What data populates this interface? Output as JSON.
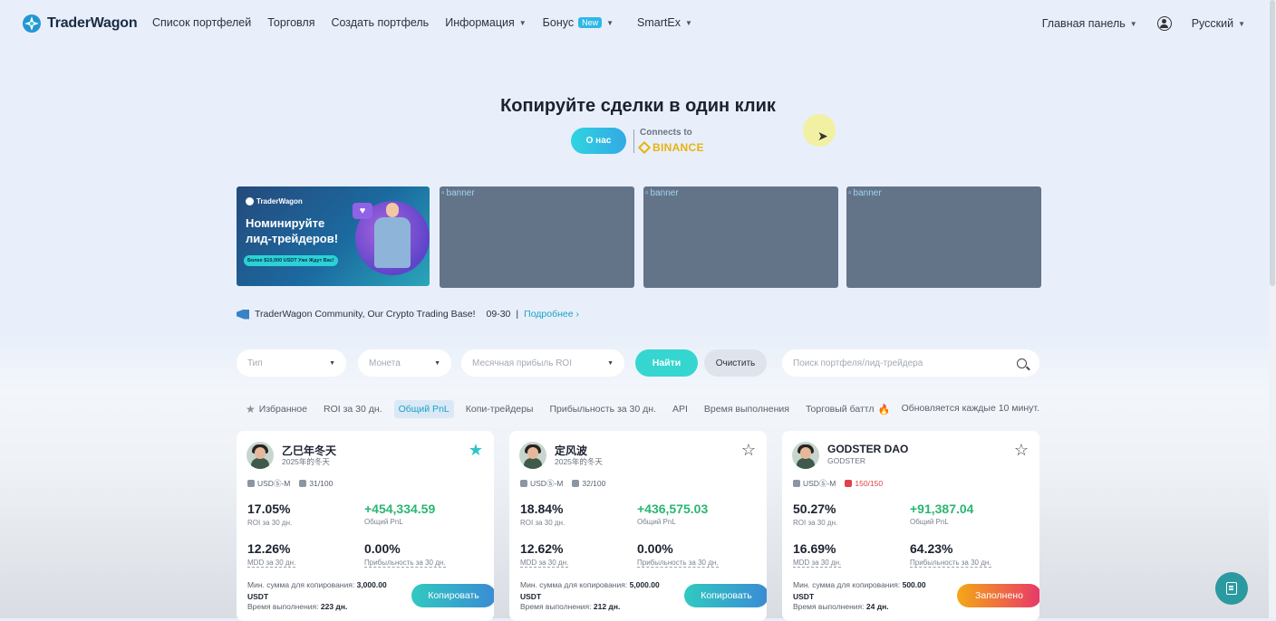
{
  "header": {
    "logo_text": "TraderWagon",
    "nav": [
      {
        "label": "Список портфелей"
      },
      {
        "label": "Торговля"
      },
      {
        "label": "Создать портфель"
      },
      {
        "label": "Информация"
      },
      {
        "label": "Бонус",
        "badge": "New"
      },
      {
        "label": "SmartEx"
      }
    ],
    "dashboard": "Главная панель",
    "language": "Русский"
  },
  "hero": {
    "title": "Копируйте сделки в один клик",
    "about_button": "О нас",
    "connects_to": "Connects to",
    "partner": "BINANCE"
  },
  "banners": {
    "main": {
      "logo": "TraderWagon",
      "title_line1": "Номинируйте",
      "title_line2": "лид-трейдеров!",
      "pill": "Более $10,000 USDT Уже Ждут Вас!"
    },
    "broken_alt": "banner"
  },
  "announcement": {
    "text": "TraderWagon Community, Our Crypto Trading Base!",
    "date": "09-30",
    "separator": "|",
    "more": "Подробнее",
    "more_icon": "chevron-right-icon"
  },
  "filters": {
    "type": "Тип",
    "coin": "Монета",
    "roi": "Месячная прибыль ROI",
    "find": "Найти",
    "clear": "Очистить",
    "search_placeholder": "Поиск портфеля/лид-трейдера"
  },
  "tabs": [
    {
      "label": "Избранное"
    },
    {
      "label": "ROI за 30 дн."
    },
    {
      "label": "Общий PnL",
      "active": true
    },
    {
      "label": "Копи-трейдеры"
    },
    {
      "label": "Прибыльность за 30 дн."
    },
    {
      "label": "API"
    },
    {
      "label": "Время выполнения"
    },
    {
      "label": "Торговый баттл"
    }
  ],
  "updates_note": "Обновляется каждые 10 минут.",
  "cards": [
    {
      "name": "乙巳年冬天",
      "sub": "2025年的冬天",
      "favorited": true,
      "market": "USDⓈ-M",
      "copiers": "31/100",
      "copiers_full": false,
      "roi": "17.05%",
      "roi_label": "ROI за 30 дн.",
      "pnl": "+454,334.59",
      "pnl_label": "Общий PnL",
      "mdd": "12.26%",
      "mdd_label": "MDD за 30 дн.",
      "win": "0.00%",
      "win_label": "Прибыльность за 30 дн.",
      "min_label": "Мин. сумма для копирования:",
      "min_value": "3,000.00",
      "currency": "USDT",
      "exec_label": "Время выполнения:",
      "exec_value": "223 дн.",
      "button": "Копировать",
      "full": false
    },
    {
      "name": "定风波",
      "sub": "2025年的冬天",
      "favorited": false,
      "market": "USDⓈ-M",
      "copiers": "32/100",
      "copiers_full": false,
      "roi": "18.84%",
      "roi_label": "ROI за 30 дн.",
      "pnl": "+436,575.03",
      "pnl_label": "Общий PnL",
      "mdd": "12.62%",
      "mdd_label": "MDD за 30 дн.",
      "win": "0.00%",
      "win_label": "Прибыльность за 30 дн.",
      "min_label": "Мин. сумма для копирования:",
      "min_value": "5,000.00",
      "currency": "USDT",
      "exec_label": "Время выполнения:",
      "exec_value": "212 дн.",
      "button": "Копировать",
      "full": false
    },
    {
      "name": "GODSTER DAO",
      "sub": "GODSTER",
      "favorited": false,
      "market": "USDⓈ-M",
      "copiers": "150/150",
      "copiers_full": true,
      "roi": "50.27%",
      "roi_label": "ROI за 30 дн.",
      "pnl": "+91,387.04",
      "pnl_label": "Общий PnL",
      "mdd": "16.69%",
      "mdd_label": "MDD за 30 дн.",
      "win": "64.23%",
      "win_label": "Прибыльность за 30 дн.",
      "min_label": "Мин. сумма для копирования:",
      "min_value": "500.00",
      "currency": "USDT",
      "exec_label": "Время выполнения:",
      "exec_value": "24 дн.",
      "button": "Заполнено",
      "full": true
    }
  ],
  "colors": {
    "accent": "#36d6d0",
    "positive": "#2bb673",
    "star_active": "#2fc3c7",
    "full": "#e8376a"
  }
}
